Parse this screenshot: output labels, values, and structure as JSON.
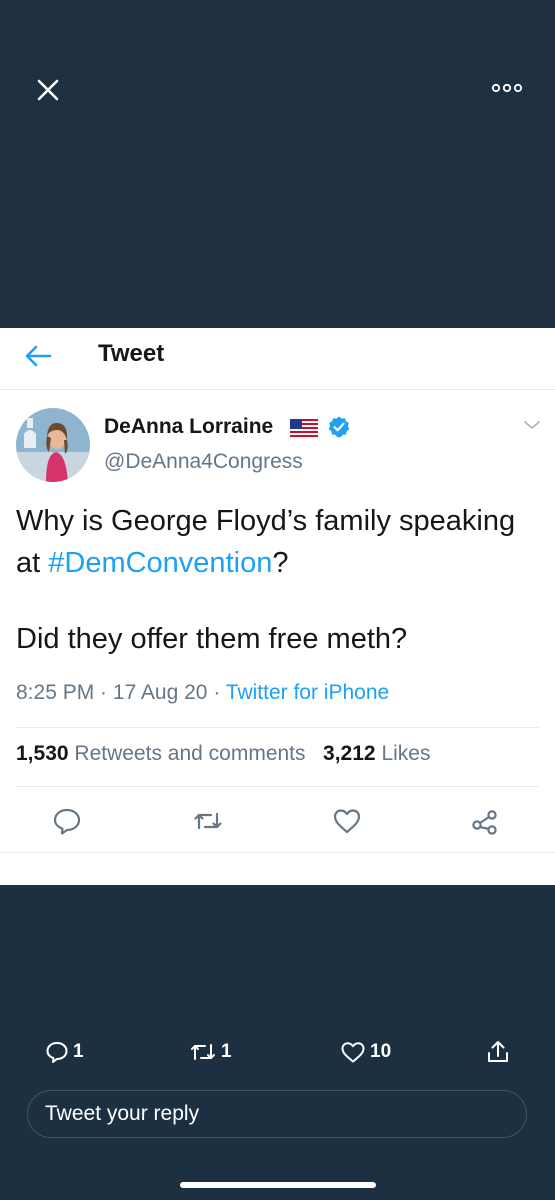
{
  "viewer": {
    "close_icon": "close-icon",
    "more_icon": "more-icon"
  },
  "header": {
    "back_icon": "back-arrow-icon",
    "title": "Tweet"
  },
  "tweet": {
    "author_name": "DeAnna Lorraine",
    "handle": "@DeAnna4Congress",
    "text_line1_prefix": "Why is George Floyd’s family speaking at ",
    "hashtag": "#DemConvention",
    "text_line1_suffix": "?",
    "text_line2": "Did they offer them free meth?",
    "time": "8:25 PM",
    "separator": " · ",
    "date": "17 Aug 20",
    "source": "Twitter for iPhone",
    "retweets_count": "1,530",
    "retweets_label": "Retweets and comments",
    "likes_count": "3,212",
    "likes_label": "Likes"
  },
  "bottom_bar": {
    "replies": "1",
    "retweets": "1",
    "likes": "10",
    "reply_placeholder": "Tweet your reply"
  },
  "colors": {
    "background": "#1d3041",
    "accent": "#1da1f2",
    "text": "#14171a",
    "secondary_text": "#657786"
  }
}
